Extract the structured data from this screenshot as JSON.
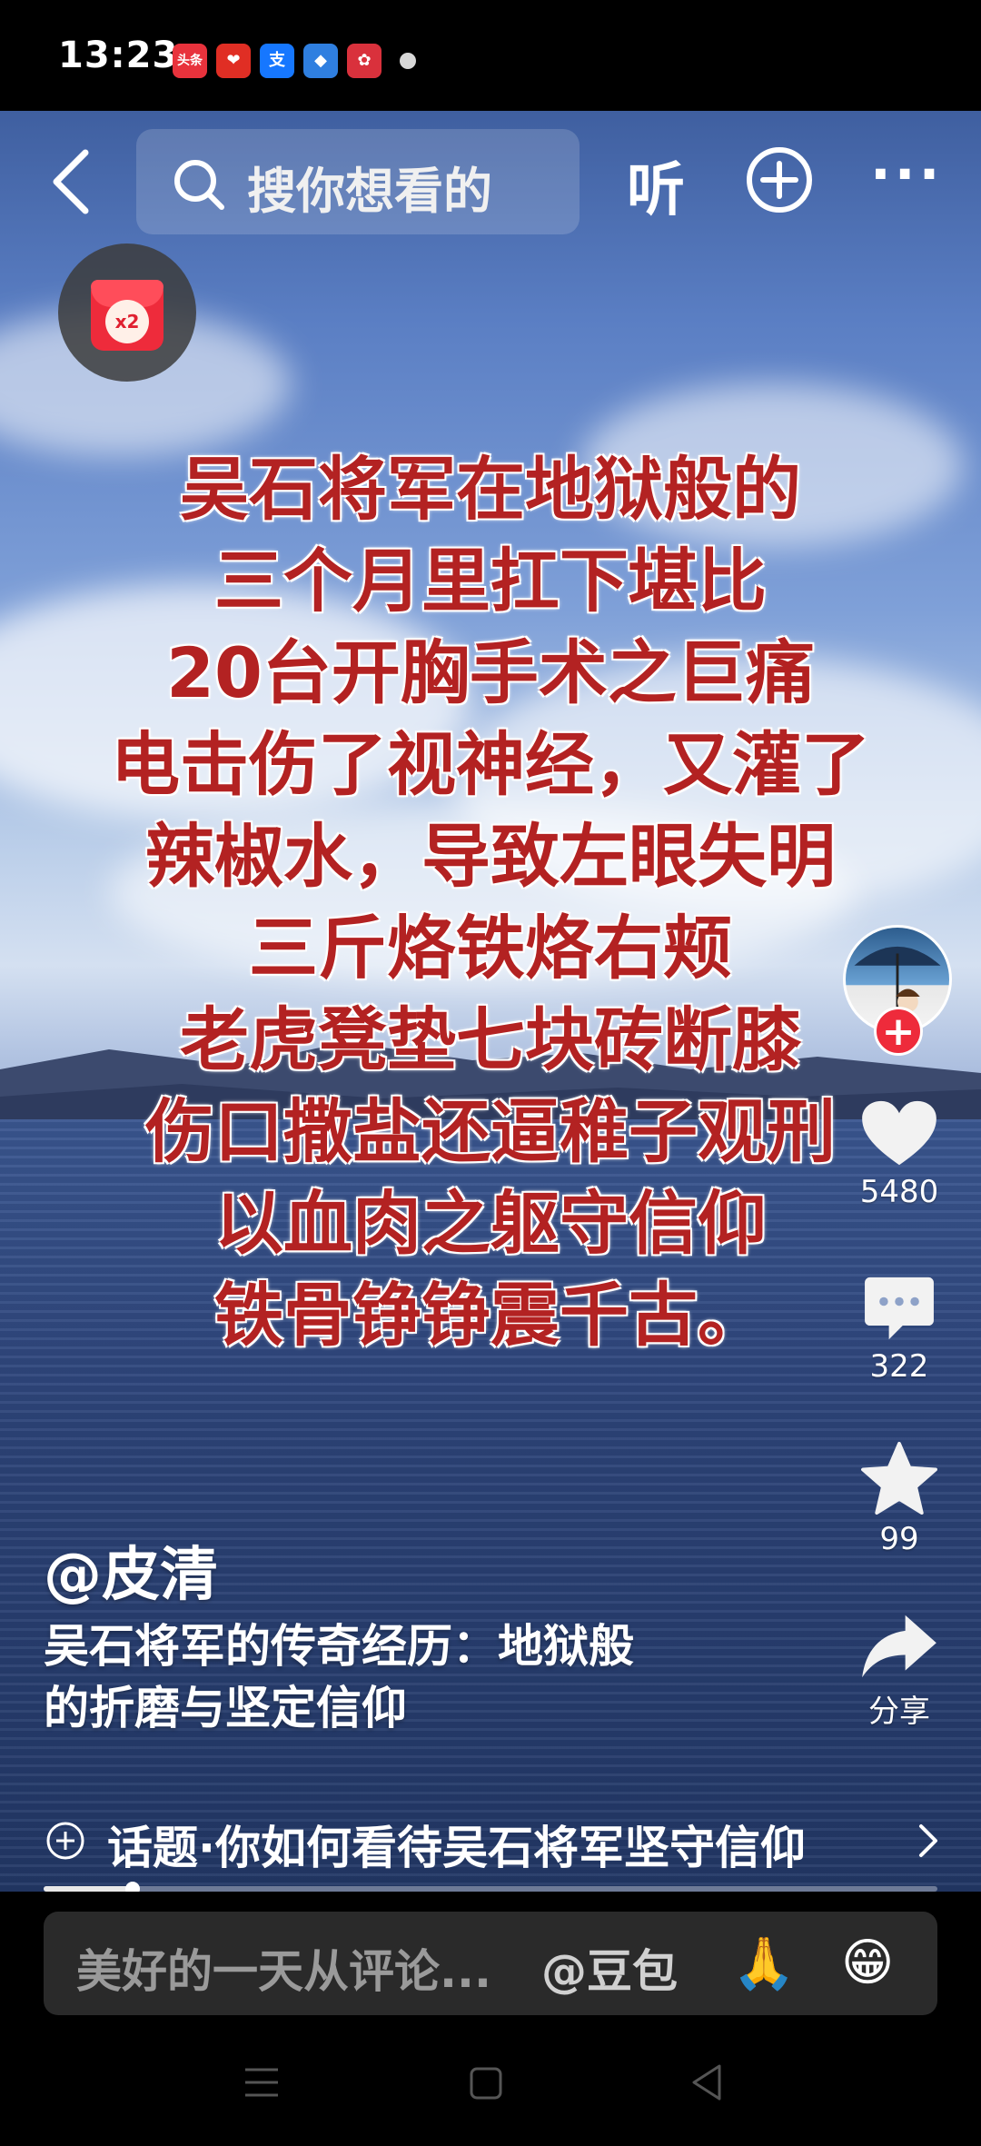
{
  "status_bar": {
    "time": "13:23",
    "app_icons": [
      {
        "name": "toutiao-icon",
        "label": "头条",
        "color": "#e8323c"
      },
      {
        "name": "pinduoduo-icon",
        "label": "❤",
        "color": "#e02e24"
      },
      {
        "name": "alipay-icon",
        "label": "支",
        "color": "#1677ff"
      },
      {
        "name": "app-blue-icon",
        "label": "◆",
        "color": "#2f7fe0"
      },
      {
        "name": "app-red-icon",
        "label": "✿",
        "color": "#d9313c"
      }
    ]
  },
  "top_bar": {
    "search_placeholder": "搜你想看的",
    "listen_label": "听",
    "more_label": "···"
  },
  "red_packet": {
    "badge": "x2"
  },
  "overlay_text": [
    "吴石将军在地狱般的",
    "三个月里扛下堪比",
    "20台开胸手术之巨痛",
    "电击伤了视神经，又灌了",
    "辣椒水，导致左眼失明",
    "三斤烙铁烙右颊",
    "老虎凳垫七块砖断膝",
    "伤口撒盐还逼稚子观刑",
    "以血肉之躯守信仰",
    "铁骨铮铮震千古。"
  ],
  "actions": {
    "likes": "5480",
    "comments": "322",
    "favorites": "99",
    "share_label": "分享"
  },
  "post": {
    "username": "@皮清",
    "caption_line1": "吴石将军的传奇经历：地狱般",
    "caption_line2": "的折磨与坚定信仰"
  },
  "topic": {
    "text": "话题·你如何看待吴石将军坚守信仰"
  },
  "progress": {
    "fraction": 0.1
  },
  "comment_bar": {
    "placeholder": "美好的一天从评论...",
    "mention": "@豆包",
    "emoji_1": "🙏",
    "emoji_2": "😁"
  }
}
